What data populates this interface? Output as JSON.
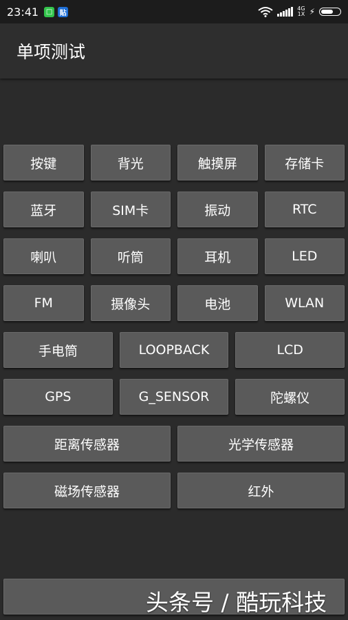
{
  "status": {
    "time": "23:41",
    "notif_a": "□",
    "notif_b": "贴",
    "net_top": "4G",
    "net_bottom": "1X",
    "battery_level": 0.65
  },
  "app": {
    "title": "单项测试"
  },
  "grid": {
    "rows": [
      [
        "按键",
        "背光",
        "触摸屏",
        "存储卡"
      ],
      [
        "蓝牙",
        "SIM卡",
        "振动",
        "RTC"
      ],
      [
        "喇叭",
        "听筒",
        "耳机",
        "LED"
      ],
      [
        "FM",
        "摄像头",
        "电池",
        "WLAN"
      ],
      [
        "手电筒",
        "LOOPBACK",
        "LCD"
      ],
      [
        "GPS",
        "G_SENSOR",
        "陀螺仪"
      ],
      [
        "距离传感器",
        "光学传感器"
      ],
      [
        "磁场传感器",
        "红外"
      ]
    ]
  },
  "watermark": "头条号 / 酷玩科技",
  "colors": {
    "background": "#2b2b2b",
    "button": "#5a5a5a",
    "appbar": "#2e2e2e"
  }
}
